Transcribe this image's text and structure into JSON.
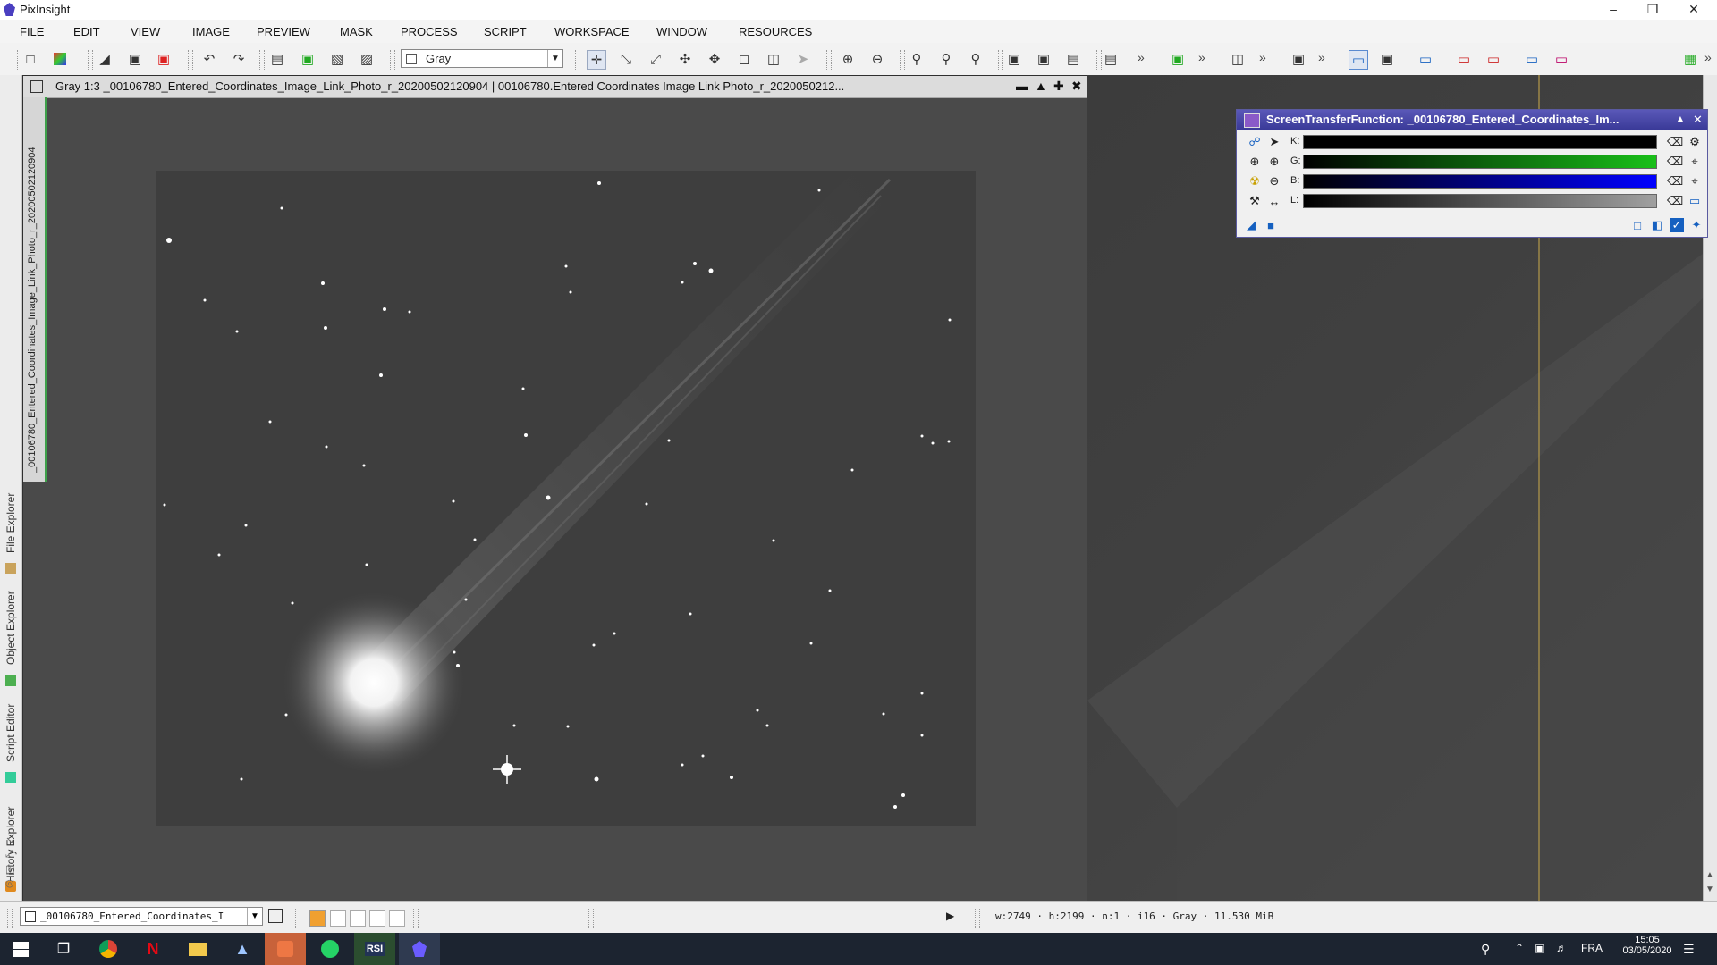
{
  "window": {
    "title": "PixInsight"
  },
  "menu": [
    "FILE",
    "EDIT",
    "VIEW",
    "IMAGE",
    "PREVIEW",
    "MASK",
    "PROCESS",
    "SCRIPT",
    "WORKSPACE",
    "WINDOW",
    "RESOURCES"
  ],
  "toolbar": {
    "view_select": "Gray"
  },
  "image_window": {
    "title": "Gray 1:3 _00106780_Entered_Coordinates_Image_Link_Photo_r_20200502120904 | 00106780.Entered Coordinates  Image Link Photo_r_2020050212...",
    "vertical_id": "_00106780_Entered_Coordinates_Image_Link_Photo_r_20200502120904"
  },
  "dock_tabs": [
    "File Explorer",
    "Object Explorer",
    "Script Editor",
    "History Explorer"
  ],
  "stf": {
    "title": "ScreenTransferFunction: _00106780_Entered_Coordinates_Im...",
    "channels": [
      {
        "label": "K:",
        "color": "#000000"
      },
      {
        "label": "G:",
        "color": "#19c019"
      },
      {
        "label": "B:",
        "color": "#0000ff"
      },
      {
        "label": "L:",
        "color": "#a0a0a0"
      }
    ]
  },
  "statusbar": {
    "view_combo": "_00106780_Entered_Coordinates_I",
    "info": "w:2749 · h:2199 · n:1 · i16 · Gray · 11.530 MiB"
  },
  "taskbar": {
    "language": "FRA",
    "time": "15:05",
    "date": "03/05/2020"
  }
}
